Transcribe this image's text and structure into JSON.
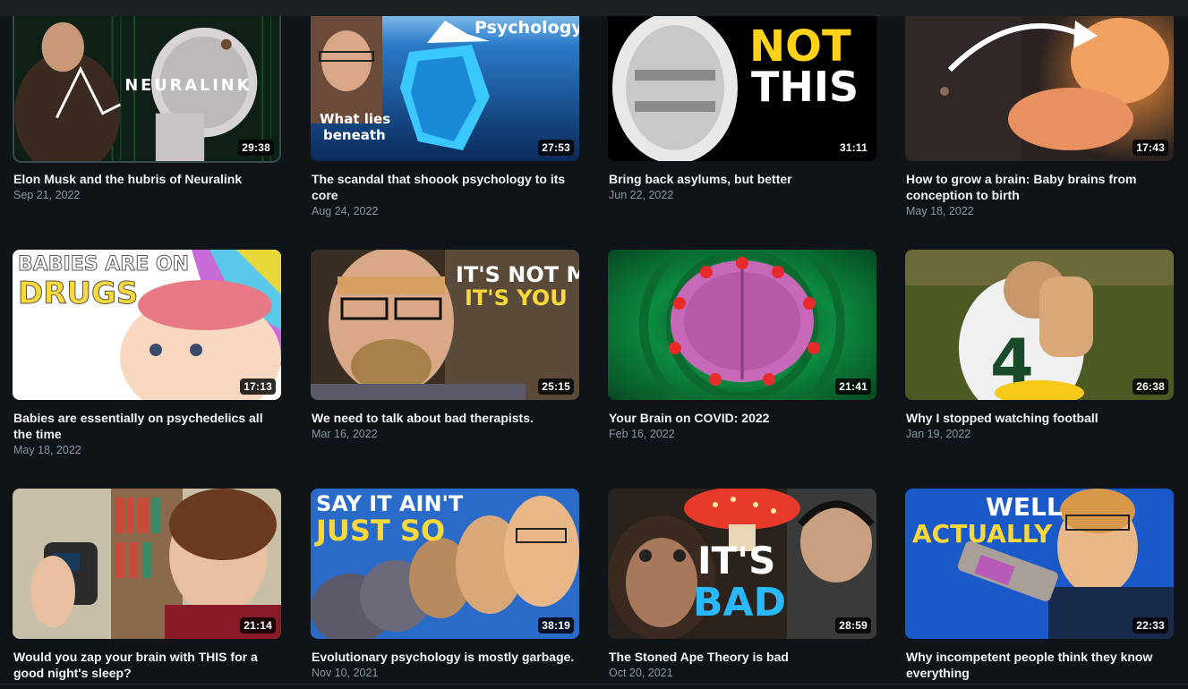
{
  "videos": [
    {
      "title": "Elon Musk and the hubris of Neuralink",
      "date": "Sep 21, 2022",
      "duration": "29:38",
      "thumb_text": [
        "NEURALINK"
      ],
      "colors": [
        "#1b3a2a",
        "#0c1a12"
      ]
    },
    {
      "title": "The scandal that shoook psychology to its core",
      "date": "Aug 24, 2022",
      "duration": "27:53",
      "thumb_text": [
        "Psychology",
        "What lies",
        "beneath"
      ],
      "colors": [
        "#2a78c8",
        "#0a2a5a"
      ]
    },
    {
      "title": "Bring back asylums, but better",
      "date": "Jun 22, 2022",
      "duration": "31:11",
      "thumb_text": [
        "NOT",
        "THIS"
      ],
      "colors": [
        "#000000",
        "#1a1a1a"
      ]
    },
    {
      "title": "How to grow a brain: Baby brains from conception to birth",
      "date": "May 18, 2022",
      "duration": "17:43",
      "thumb_text": [],
      "colors": [
        "#3a3230",
        "#1a1412"
      ]
    },
    {
      "title": "Babies are essentially on psychedelics all the time",
      "date": "May 18, 2022",
      "duration": "17:13",
      "thumb_text": [
        "BABIES ARE ON",
        "DRUGS"
      ],
      "colors": [
        "#ffffff",
        "#f0f0f0"
      ]
    },
    {
      "title": "We need to talk about bad therapists.",
      "date": "Mar 16, 2022",
      "duration": "25:15",
      "thumb_text": [
        "IT'S NOT ME,",
        "IT'S YOU"
      ],
      "colors": [
        "#4a3a2a",
        "#2a2018"
      ]
    },
    {
      "title": "Your Brain on COVID: 2022",
      "date": "Feb 16, 2022",
      "duration": "21:41",
      "thumb_text": [],
      "colors": [
        "#0d7a3a",
        "#064a22"
      ]
    },
    {
      "title": "Why I stopped watching football",
      "date": "Jan 19, 2022",
      "duration": "26:38",
      "thumb_text": [],
      "colors": [
        "#5a6a2a",
        "#3a4a1a"
      ]
    },
    {
      "title": "Would you zap your brain with THIS for a good night's sleep?",
      "date": "",
      "duration": "21:14",
      "thumb_text": [],
      "colors": [
        "#c8bfa8",
        "#8a7a5a"
      ]
    },
    {
      "title": "Evolutionary psychology is mostly garbage.",
      "date": "Nov 10, 2021",
      "duration": "38:19",
      "thumb_text": [
        "SAY IT AIN'T",
        "JUST SO"
      ],
      "colors": [
        "#2a6ac8",
        "#1a3a8a"
      ]
    },
    {
      "title": "The Stoned Ape Theory is bad",
      "date": "Oct 20, 2021",
      "duration": "28:59",
      "thumb_text": [
        "IT'S",
        "BAD"
      ],
      "colors": [
        "#3a2a20",
        "#1a1410"
      ]
    },
    {
      "title": "Why incompetent people think they know everything",
      "date": "",
      "duration": "22:33",
      "thumb_text": [
        "WELL",
        "ACTUALLY"
      ],
      "colors": [
        "#1a5ac8",
        "#0a3a8a"
      ]
    }
  ]
}
